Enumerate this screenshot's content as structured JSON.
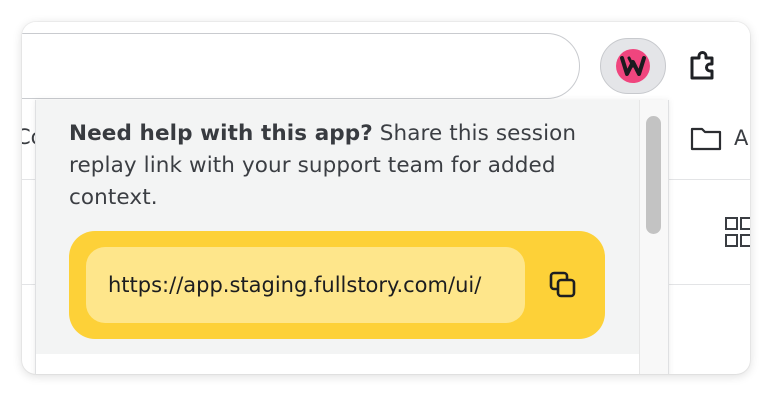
{
  "toolbar": {
    "extension_active_icon": "fullstory-w-logo",
    "extension_puzzle_icon": "puzzle-icon",
    "active_color": "#f0457e"
  },
  "background": {
    "left_text": "Co",
    "folder_icon": "folder-icon",
    "folder_letter": "A",
    "grid_icon": "grid-icon"
  },
  "popup": {
    "message_bold": "Need help with this app?",
    "message_rest": " Share this session replay link with your support team for added context.",
    "link_value": "https://app.staging.fullstory.com/ui/",
    "copy_icon": "copy-icon",
    "card_color": "#fdd138",
    "field_color": "#fee68b"
  }
}
